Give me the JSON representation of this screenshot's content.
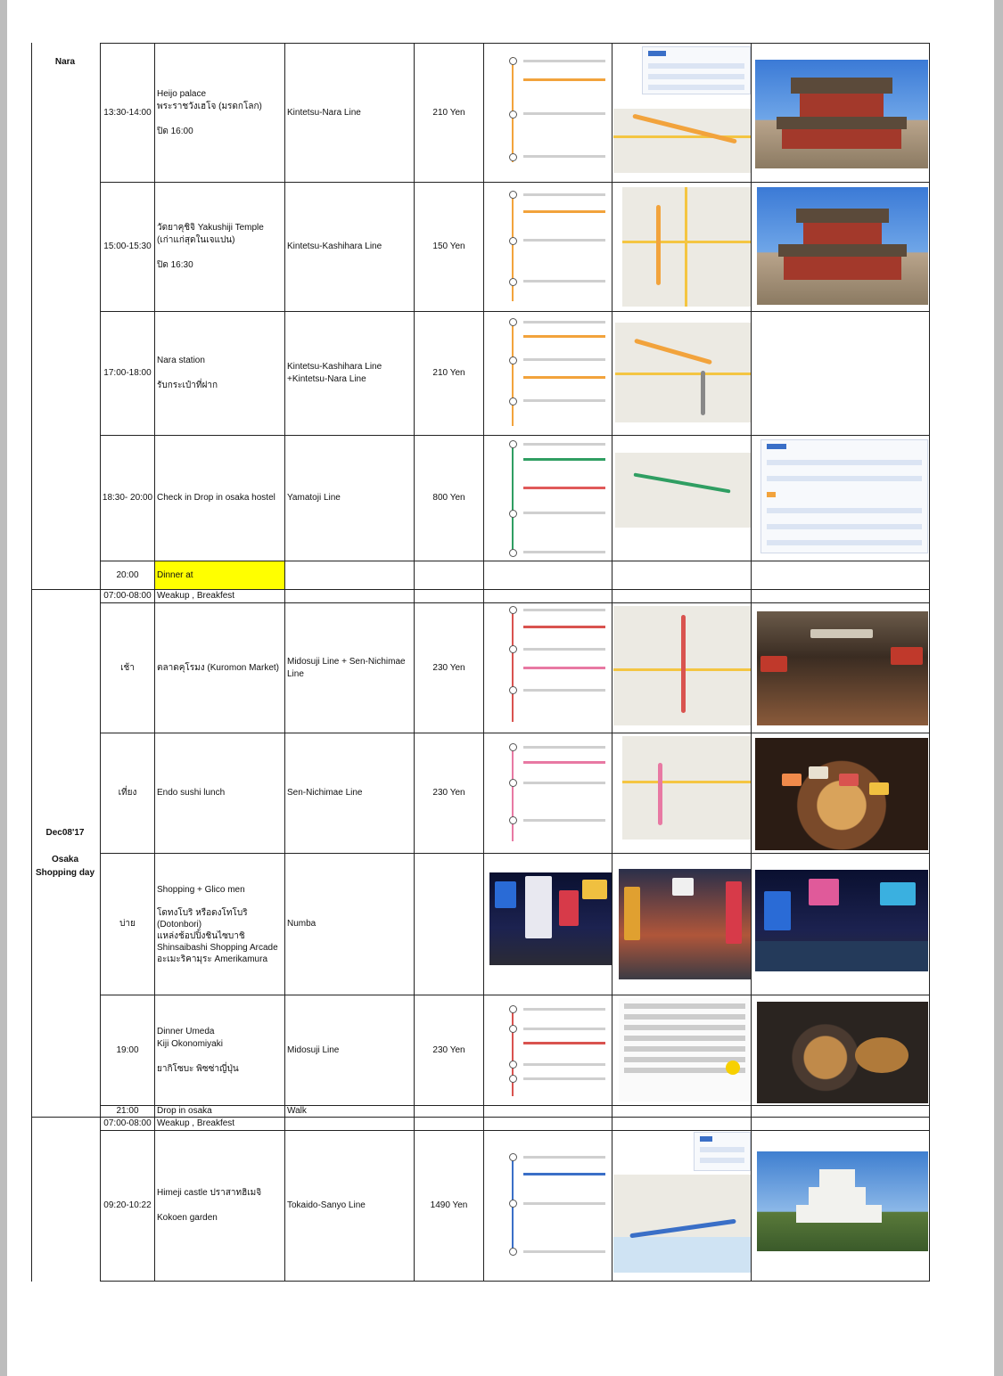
{
  "days": [
    {
      "label": "Nara"
    },
    {
      "date": "Dec08'17",
      "title": "Osaka",
      "subtitle": "Shopping day"
    }
  ],
  "rows": [
    {
      "time": "13:30-14:00",
      "activity": [
        "Heijo palace",
        "พระราชวังเฮโจ  (มรดกโลก)",
        "",
        "ปิด  16:00"
      ],
      "line": [
        "Kintetsu-Nara Line"
      ],
      "fare": "210 Yen"
    },
    {
      "time": "15:00-15:30",
      "activity": [
        "วัดยาคุชิจิ  Yakushiji Temple",
        "(เก่าแก่สุดในเจแปน)",
        "",
        "ปิด  16:30"
      ],
      "line": [
        "Kintetsu-Kashihara Line"
      ],
      "fare": "150 Yen"
    },
    {
      "time": "17:00-18:00",
      "activity": [
        "Nara station",
        "",
        "รับกระเป๋าที่ฝาก"
      ],
      "line": [
        "Kintetsu-Kashihara Line",
        "+Kintetsu-Nara Line"
      ],
      "fare": "210 Yen"
    },
    {
      "time": "18:30- 20:00",
      "activity": [
        "Check in Drop in osaka hostel"
      ],
      "line": [
        "Yamatoji Line"
      ],
      "fare": "800 Yen"
    },
    {
      "time": "20:00",
      "activity": [
        "Dinner at"
      ],
      "line": [],
      "fare": "",
      "highlight": "#ffff00"
    },
    {
      "time": "07:00-08:00",
      "activity": [
        "Weakup , Breakfest"
      ],
      "line": [],
      "fare": ""
    },
    {
      "time": "เช้า",
      "activity": [
        "ตลาดคุโรมง  (Kuromon Market)"
      ],
      "line": [
        "Midosuji Line + Sen-Nichimae",
        "Line"
      ],
      "fare": "230 Yen"
    },
    {
      "time": "เที่ยง",
      "activity": [
        "Endo sushi lunch"
      ],
      "line": [
        "Sen-Nichimae Line"
      ],
      "fare": "230 Yen"
    },
    {
      "time": "บ่าย",
      "activity": [
        "Shopping + Glico men",
        "",
        "โดทงโบริ  หรือดงโทโบริ",
        "(Dotonbori)",
        "แหล่งช้อปปิ้งชินไซบาชิ",
        "Shinsaibashi Shopping Arcade",
        "อะเมะริคามุระ  Amerikamura"
      ],
      "line": [
        "Numba"
      ],
      "fare": ""
    },
    {
      "time": "19:00",
      "activity": [
        "Dinner Umeda",
        "Kiji Okonomiyaki",
        "",
        "ยากิโซบะ  พิซซ่าญี่ปุ่น"
      ],
      "line": [
        "Midosuji Line"
      ],
      "fare": "230 Yen"
    },
    {
      "time": "21:00",
      "activity": [
        "Drop in osaka"
      ],
      "line": [
        "Walk"
      ],
      "fare": ""
    },
    {
      "time": "07:00-08:00",
      "activity": [
        "Weakup , Breakfest"
      ],
      "line": [],
      "fare": ""
    },
    {
      "time": "09:20-10:22",
      "activity": [
        "Himeji castle ปราสาทฮิเมจิ",
        "",
        "Kokoen garden"
      ],
      "line": [
        "Tokaido-Sanyo Line"
      ],
      "fare": "1490 Yen"
    }
  ],
  "image_names": [
    "route-screenshot",
    "map-screenshot",
    "photo"
  ]
}
